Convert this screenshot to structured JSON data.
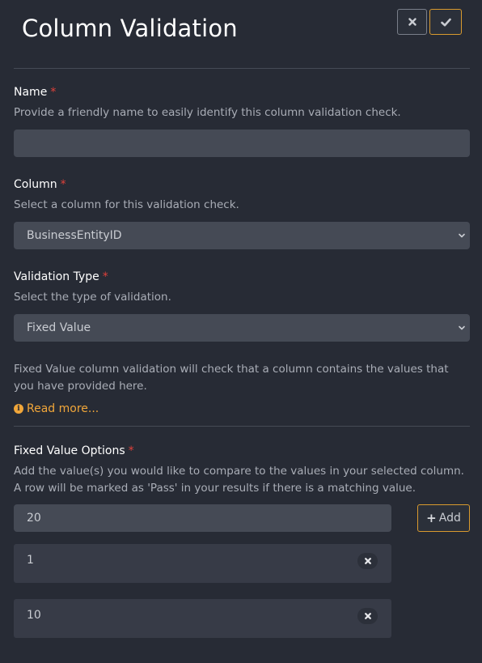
{
  "header": {
    "title": "Column Validation",
    "cancel_icon": "close-icon",
    "confirm_icon": "check-icon",
    "accent_color": "#d99a2e"
  },
  "name_section": {
    "label": "Name",
    "required_mark": "*",
    "help": "Provide a friendly name to easily identify this column validation check.",
    "value": ""
  },
  "column_section": {
    "label": "Column",
    "required_mark": "*",
    "help": "Select a column for this validation check.",
    "selected": "BusinessEntityID"
  },
  "validation_type_section": {
    "label": "Validation Type",
    "required_mark": "*",
    "help": "Select the type of validation.",
    "selected": "Fixed Value",
    "description": "Fixed Value column validation will check that a column contains the values that you have provided here.",
    "read_more": "Read more..."
  },
  "fixed_values_section": {
    "label": "Fixed Value Options",
    "required_mark": "*",
    "help": "Add the value(s) you would like to compare to the values in your selected column. A row will be marked as 'Pass' in your results if there is a matching value.",
    "input_value": "20",
    "add_label": "Add",
    "values": [
      "1",
      "10"
    ]
  }
}
